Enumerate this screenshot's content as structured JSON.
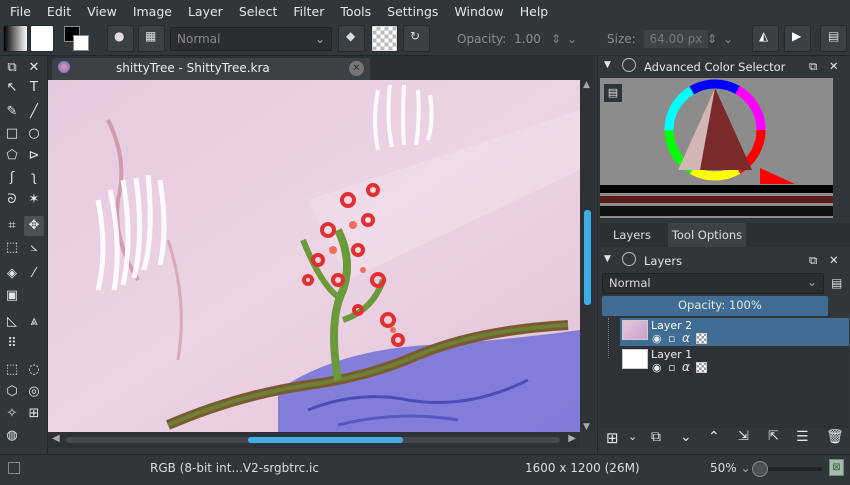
{
  "menu": [
    "File",
    "Edit",
    "View",
    "Image",
    "Layer",
    "Select",
    "Filter",
    "Tools",
    "Settings",
    "Window",
    "Help"
  ],
  "toolbar": {
    "blend_mode": "Normal",
    "opacity_label": "Opacity:",
    "opacity_value": "1.00",
    "size_label": "Size:",
    "size_value": "64.00 px"
  },
  "document": {
    "tab_title": "shittyTree - ShittyTree.kra"
  },
  "color_selector": {
    "title": "Advanced Color Selector"
  },
  "panel_tabs": [
    "Layers",
    "Tool Options"
  ],
  "layers_docker": {
    "title": "Layers",
    "blend_mode": "Normal",
    "opacity": "Opacity:  100%",
    "layers": [
      {
        "name": "Layer 2",
        "selected": true
      },
      {
        "name": "Layer 1",
        "selected": false
      }
    ]
  },
  "status": {
    "color_profile": "RGB (8-bit int...V2-srgbtrc.ic",
    "dimensions": "1600 x 1200 (26M)",
    "zoom": "50%"
  },
  "colors": {
    "accent": "#3daee9",
    "selection": "#3f6d94",
    "background": "#31363b",
    "canvas": "#e8cfe0"
  }
}
